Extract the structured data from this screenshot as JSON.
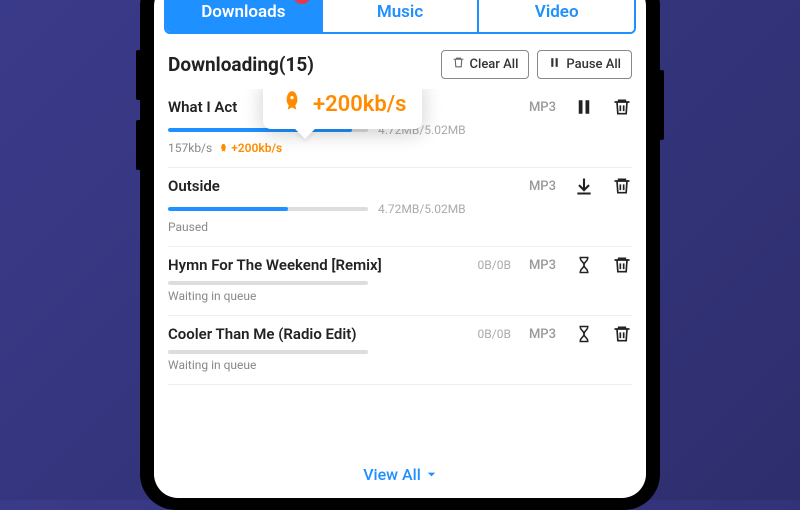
{
  "tabs": {
    "downloads": "Downloads",
    "music": "Music",
    "video": "Video"
  },
  "header": {
    "title": "Downloading(15)",
    "clear_all": "Clear All",
    "pause_all": "Pause All"
  },
  "tooltip": {
    "text": "+200kb/s"
  },
  "items": [
    {
      "title": "What I Act",
      "format": "MP3",
      "size": "4.72MB/5.02MB",
      "speed": "157kb/s",
      "boost": "+200kb/s",
      "progress": 92,
      "state": "downloading"
    },
    {
      "title": "Outside",
      "format": "MP3",
      "size": "4.72MB/5.02MB",
      "status": "Paused",
      "progress": 60,
      "state": "paused"
    },
    {
      "title": "Hymn For The Weekend [Remix]",
      "format": "MP3",
      "size": "0B/0B",
      "status": "Waiting in queue",
      "progress": 0,
      "state": "waiting"
    },
    {
      "title": "Cooler Than Me (Radio Edit)",
      "format": "MP3",
      "size": "0B/0B",
      "status": "Waiting in queue",
      "progress": 0,
      "state": "waiting"
    }
  ],
  "view_all": "View All"
}
